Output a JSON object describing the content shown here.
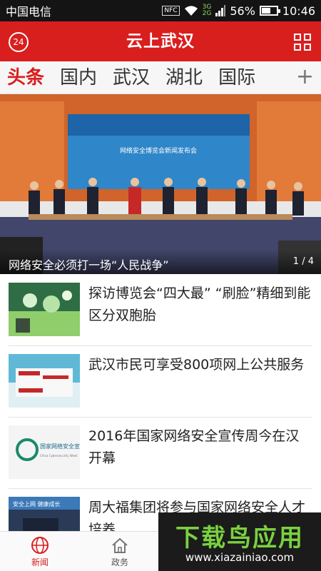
{
  "status_bar": {
    "carrier": "中国电信",
    "nfc": "NFC",
    "network_top": "3G",
    "network_bottom": "2G",
    "battery": "56%",
    "battery_level": 0.56,
    "time": "10:46"
  },
  "header": {
    "badge": "24",
    "title": "云上武汉"
  },
  "tabs": [
    {
      "label": "头条",
      "active": true
    },
    {
      "label": "国内"
    },
    {
      "label": "武汉"
    },
    {
      "label": "湖北"
    },
    {
      "label": "国际"
    }
  ],
  "tab_add": "+",
  "hero": {
    "screen_text": "网络安全博览会新闻发布会",
    "caption": "网络安全必须打一场“人民战争”",
    "page_current": "1",
    "page_total": "4"
  },
  "news": [
    {
      "title": "探访博览会“四大最” “刷脸”精细到能区分双胞胎"
    },
    {
      "title": "武汉市民可享受800项网上公共服务"
    },
    {
      "title": "2016年国家网络安全宣传周今在汉开幕",
      "logo_text": "国家网络安全宣传周",
      "logo_sub": "China Cybersecurity Week"
    },
    {
      "title": "周大福集团将参与国家网络安全人才培养",
      "thumb_text": "安全上网 健康成长"
    }
  ],
  "bottom_nav": [
    {
      "label": "新闻",
      "icon": "globe-icon",
      "active": true
    },
    {
      "label": "政务",
      "icon": "home-icon"
    }
  ],
  "watermark": {
    "title": "下载鸟应用",
    "url": "www.xiazainiao.com"
  },
  "colors": {
    "brand_red": "#d91e1e",
    "status_bar": "#141414",
    "watermark_green": "#7ad13f"
  }
}
